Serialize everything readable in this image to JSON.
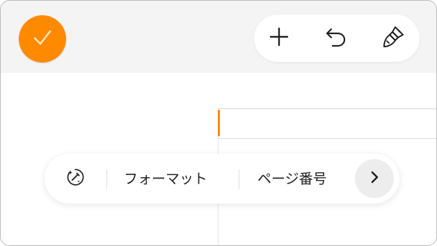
{
  "topbar": {
    "done_button": {
      "icon": "checkmark-icon",
      "color": "#ff8a00"
    },
    "toolbar": [
      {
        "icon": "plus-icon"
      },
      {
        "icon": "undo-icon"
      },
      {
        "icon": "paintbrush-icon"
      }
    ]
  },
  "document": {
    "cursor_color": "#ff8a00"
  },
  "context_menu": {
    "icon": "format-sparkle-icon",
    "items": [
      {
        "label": "フォーマット"
      },
      {
        "label": "ページ番号"
      }
    ],
    "more_icon": "chevron-right-icon"
  }
}
